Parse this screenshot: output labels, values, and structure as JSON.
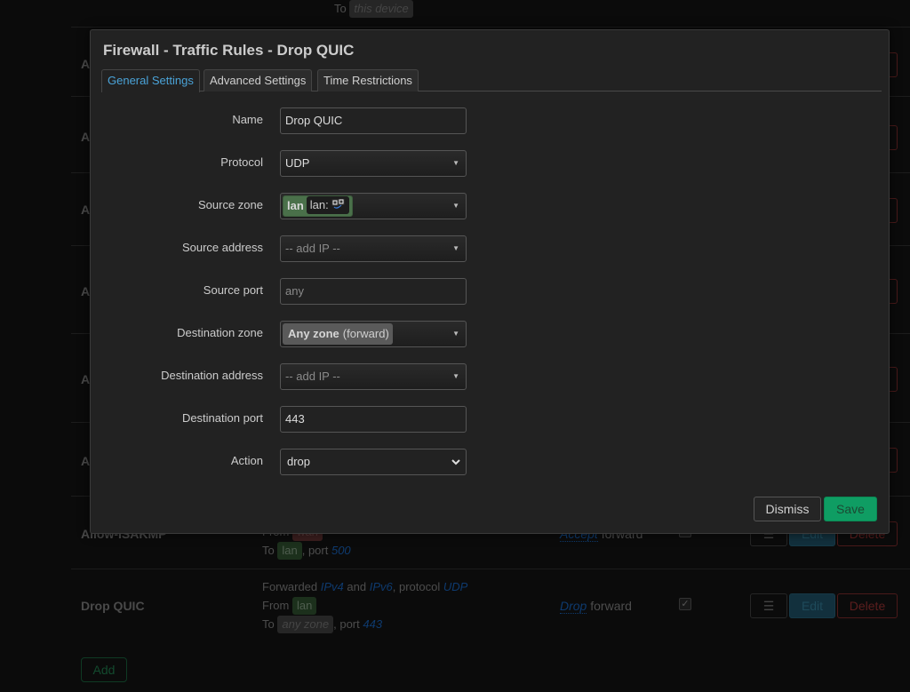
{
  "background": {
    "top_fragment": {
      "prefix": "To",
      "zone": "this device"
    },
    "rows": [
      {
        "name": "A"
      },
      {
        "name": "A"
      },
      {
        "name": "A"
      },
      {
        "name": "A"
      },
      {
        "name": "A"
      },
      {
        "name": "A"
      },
      {
        "name": "Allow-ISAKMP",
        "match_from_prefix": "From",
        "match_from_zone": "wan",
        "match_to_prefix": "To",
        "match_to_zone": "lan",
        "match_to_port_label": ", port",
        "match_to_port": "500",
        "action_verb": "Accept",
        "action_target": "forward"
      },
      {
        "name": "Drop QUIC",
        "match_line1_prefix": "Forwarded",
        "match_family1": "IPv4",
        "match_and": "and",
        "match_family2": "IPv6",
        "match_protocol_label": ", protocol",
        "match_protocol": "UDP",
        "match_from_prefix": "From",
        "match_from_zone": "lan",
        "match_to_prefix": "To",
        "match_to_zone": "any zone",
        "match_to_port_label": ", port",
        "match_to_port": "443",
        "action_verb": "Drop",
        "action_target": "forward",
        "enabled": true
      }
    ],
    "row_buttons": {
      "menu_icon": "☰",
      "edit": "Edit",
      "delete": "Delete"
    },
    "add_button": "Add"
  },
  "modal": {
    "title": "Firewall - Traffic Rules - Drop QUIC",
    "tabs": [
      {
        "label": "General Settings",
        "active": true
      },
      {
        "label": "Advanced Settings",
        "active": false
      },
      {
        "label": "Time Restrictions",
        "active": false
      }
    ],
    "fields": {
      "name": {
        "label": "Name",
        "value": "Drop QUIC"
      },
      "protocol": {
        "label": "Protocol",
        "value": "UDP"
      },
      "source_zone": {
        "label": "Source zone",
        "zone": "lan",
        "interface": "lan:"
      },
      "source_address": {
        "label": "Source address",
        "placeholder": "-- add IP --"
      },
      "source_port": {
        "label": "Source port",
        "placeholder": "any"
      },
      "destination_zone": {
        "label": "Destination zone",
        "zone": "Any zone",
        "suffix": "(forward)"
      },
      "destination_address": {
        "label": "Destination address",
        "placeholder": "-- add IP --"
      },
      "destination_port": {
        "label": "Destination port",
        "value": "443"
      },
      "action": {
        "label": "Action",
        "value": "drop"
      }
    },
    "buttons": {
      "dismiss": "Dismiss",
      "save": "Save"
    }
  }
}
